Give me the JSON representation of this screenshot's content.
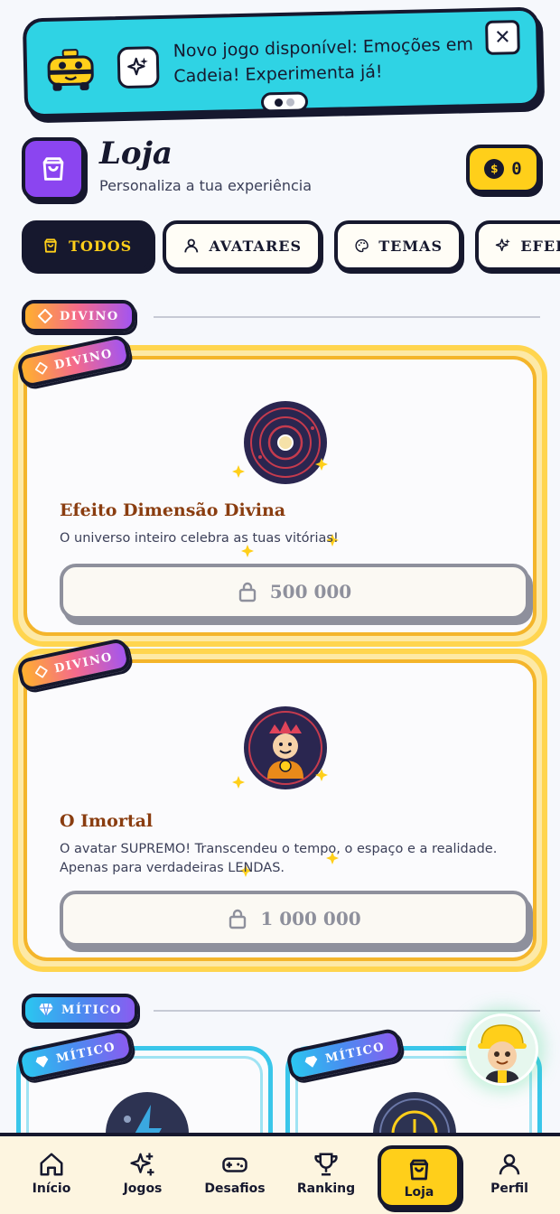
{
  "banner": {
    "text": "Novo jogo disponível: Emoções em Cadeia! Experimenta já!",
    "close_label": "✕"
  },
  "header": {
    "title": "Loja",
    "subtitle": "Personaliza a tua experiência",
    "coins": "0",
    "coin_symbol": "$"
  },
  "tabs": [
    {
      "label": "TODOS",
      "icon": "bag-icon",
      "active": true
    },
    {
      "label": "AVATARES",
      "icon": "user-icon",
      "active": false
    },
    {
      "label": "TEMAS",
      "icon": "palette-icon",
      "active": false
    },
    {
      "label": "EFEITOS",
      "icon": "sparkles-icon",
      "active": false
    }
  ],
  "sections": [
    {
      "tier": "DIVINO",
      "items": [
        {
          "badge": "DIVINO",
          "title": "Efeito Dimensão Divina",
          "description": "O universo inteiro celebra as tuas vitórias!",
          "price": "500 000",
          "locked": true
        },
        {
          "badge": "DIVINO",
          "title": "O Imortal",
          "description": "O avatar SUPREMO! Transcendeu o tempo, o espaço e a realidade. Apenas para verdadeiras LENDAS.",
          "price": "1 000 000",
          "locked": true
        }
      ]
    },
    {
      "tier": "MÍTICO",
      "items": [
        {
          "badge": "MÍTICO"
        },
        {
          "badge": "MÍTICO"
        }
      ]
    }
  ],
  "nav": [
    {
      "label": "Início",
      "icon": "home-icon"
    },
    {
      "label": "Jogos",
      "icon": "sparkles-icon"
    },
    {
      "label": "Desafios",
      "icon": "gamepad-icon"
    },
    {
      "label": "Ranking",
      "icon": "trophy-icon"
    },
    {
      "label": "Loja",
      "icon": "bag-icon",
      "active": true
    },
    {
      "label": "Perfil",
      "icon": "user-icon"
    }
  ],
  "colors": {
    "dark": "#16182e",
    "yellow": "#ffcf1a",
    "cyan": "#2fd3e4",
    "purple": "#8b45f0"
  }
}
